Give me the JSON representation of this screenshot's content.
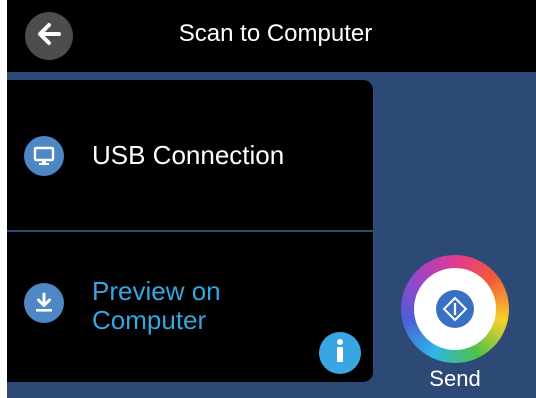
{
  "header": {
    "title": "Scan to Computer",
    "back_icon": "arrow-left-icon"
  },
  "menu": {
    "items": [
      {
        "label": "USB Connection",
        "icon": "monitor-icon"
      },
      {
        "label": "Preview on Computer",
        "line1": "Preview on",
        "line2": "Computer",
        "icon": "download-icon"
      }
    ],
    "info_icon": "info-icon"
  },
  "send": {
    "label": "Send",
    "icon": "send-diamond-icon"
  },
  "colors": {
    "background": "#2c4a75",
    "panel": "#000000",
    "icon_circle": "#4e86c6",
    "highlight_text": "#35a6e0",
    "info": "#39a6e3"
  }
}
